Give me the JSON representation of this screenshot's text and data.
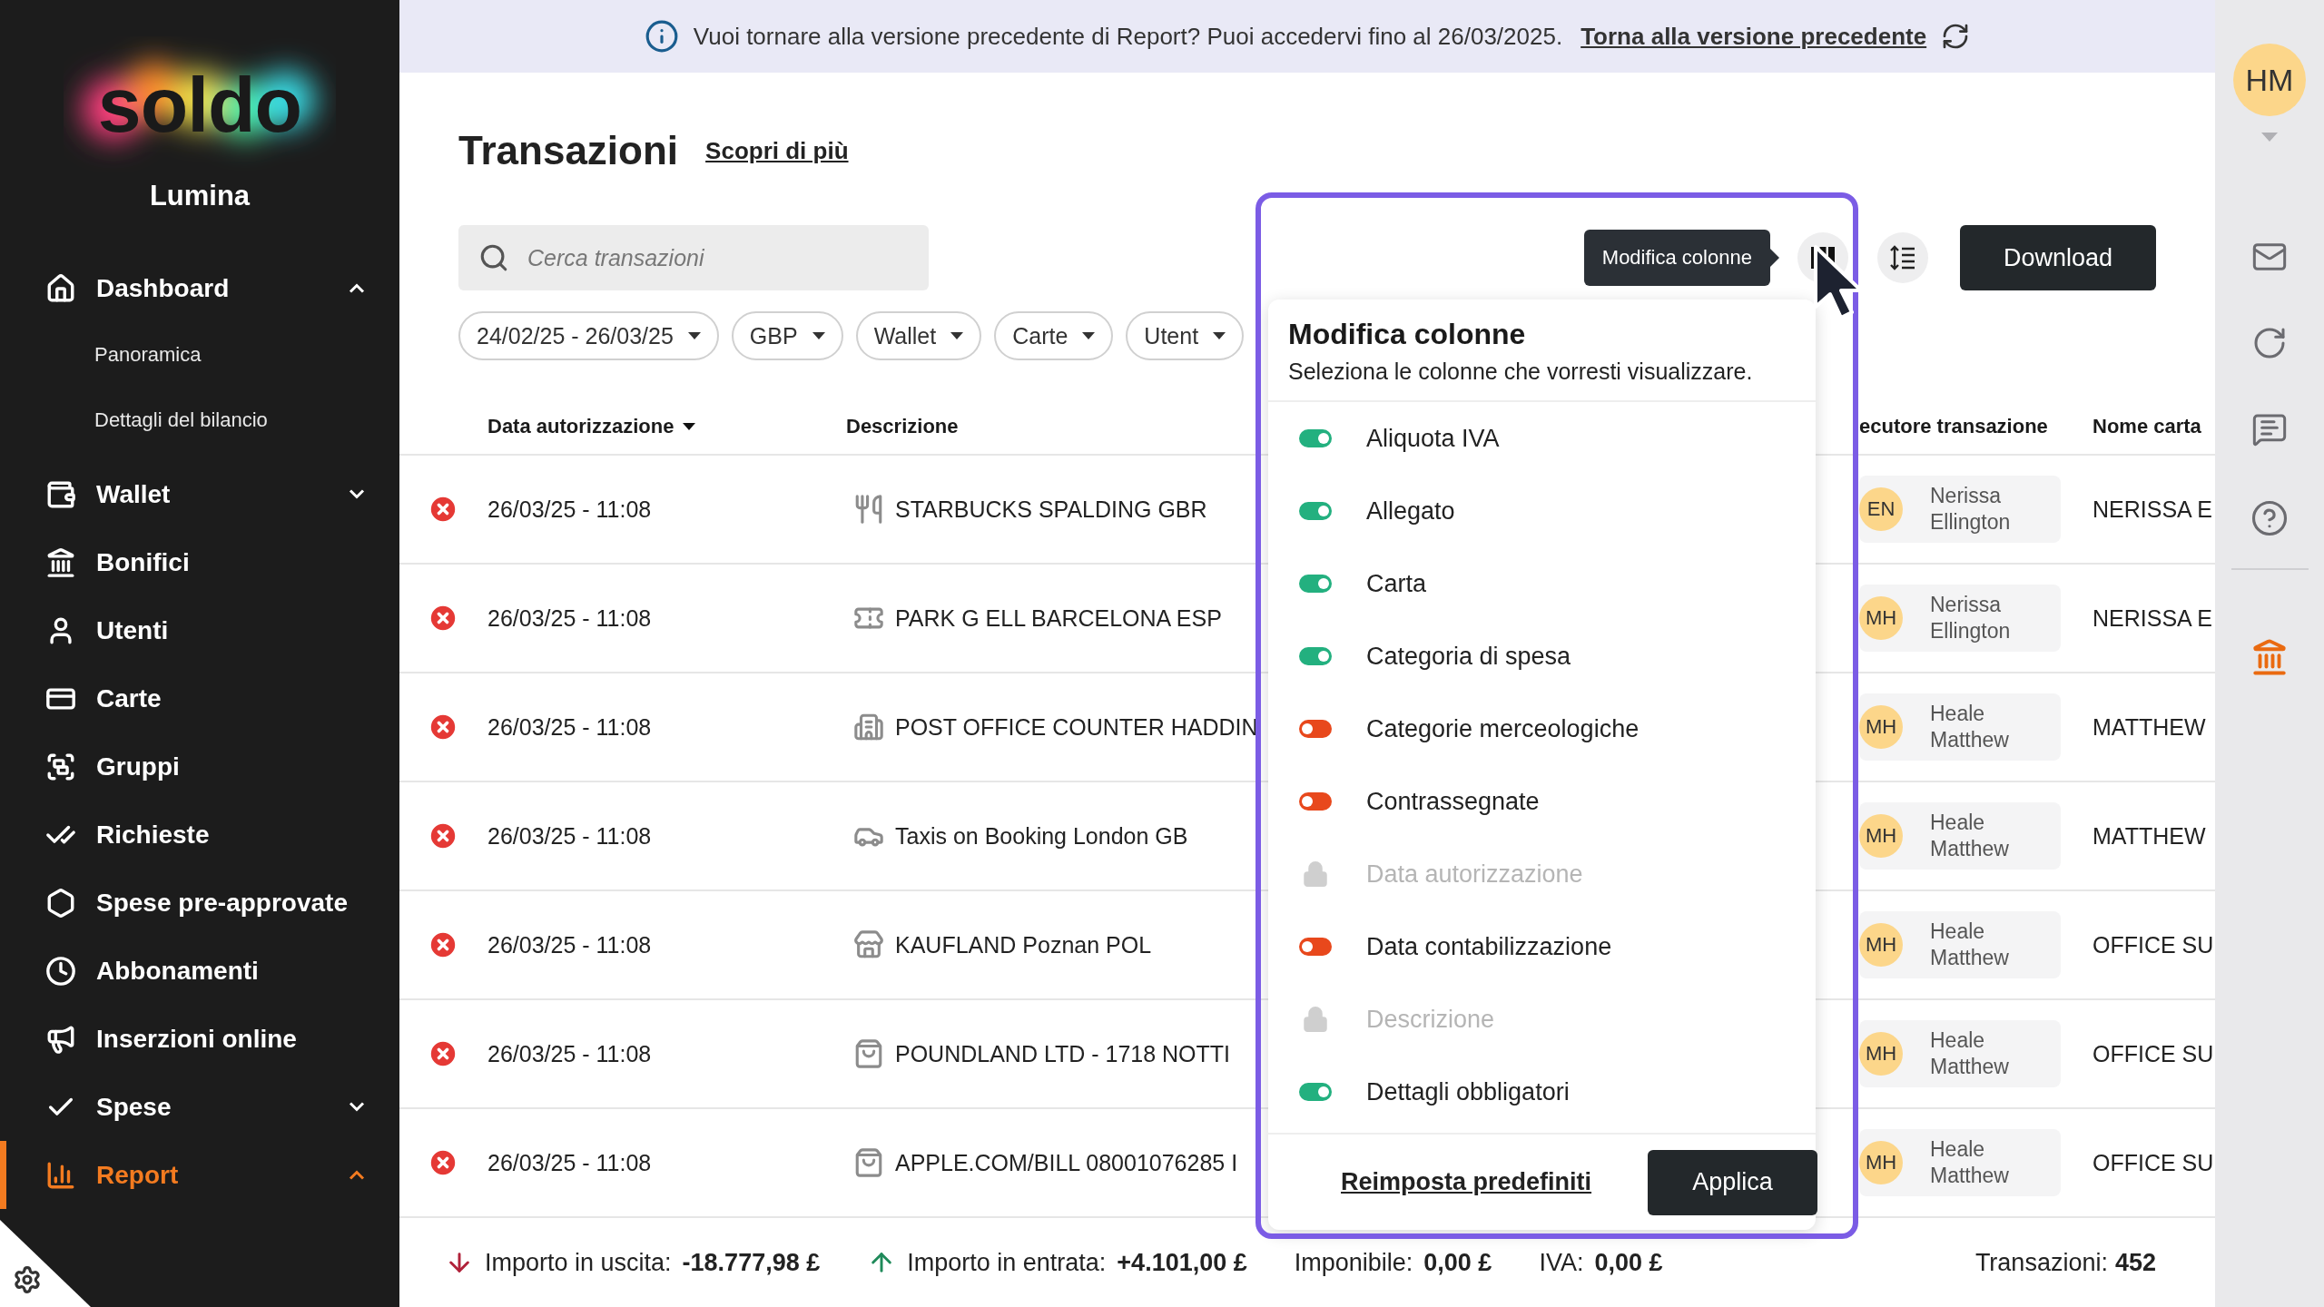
{
  "sidebar": {
    "brand": "soldo",
    "company": "Lumina",
    "items": [
      {
        "label": "Dashboard",
        "selected": false,
        "expanded": true,
        "children": [
          {
            "label": "Panoramica"
          },
          {
            "label": "Dettagli del bilancio"
          }
        ]
      },
      {
        "label": "Wallet",
        "selected": false,
        "expanded": false
      },
      {
        "label": "Bonifici",
        "selected": false
      },
      {
        "label": "Utenti",
        "selected": false
      },
      {
        "label": "Carte",
        "selected": false
      },
      {
        "label": "Gruppi",
        "selected": false
      },
      {
        "label": "Richieste",
        "selected": false
      },
      {
        "label": "Spese pre-approvate",
        "selected": false
      },
      {
        "label": "Abbonamenti",
        "selected": false
      },
      {
        "label": "Inserzioni online",
        "selected": false
      },
      {
        "label": "Spese",
        "selected": false,
        "expanded": false
      },
      {
        "label": "Report",
        "selected": true,
        "expanded": true
      }
    ]
  },
  "banner": {
    "message": "Vuoi tornare alla versione precedente di Report? Puoi accedervi fino al 26/03/2025.",
    "link": "Torna alla versione precedente"
  },
  "header": {
    "title": "Transazioni",
    "link": "Scopri di più"
  },
  "toolbar": {
    "search": {
      "placeholder": "Cerca transazioni"
    },
    "tooltip": "Modifica colonne",
    "download": "Download"
  },
  "filters": [
    {
      "label": "24/02/25 - 26/03/25"
    },
    {
      "label": "GBP"
    },
    {
      "label": "Wallet"
    },
    {
      "label": "Carte"
    },
    {
      "label": "Utent"
    }
  ],
  "table": {
    "columns": [
      {
        "label": "Data autorizzazione",
        "sorted": true
      },
      {
        "label": "Descrizione",
        "sorted": false
      },
      {
        "label": "ecutore transazione",
        "sorted": false
      },
      {
        "label": "Nome carta",
        "sorted": false
      }
    ],
    "rows": [
      {
        "date": "26/03/25 - 11:08",
        "kind": "restaurant",
        "description": "STARBUCKS SPALDING GBR",
        "executor": {
          "initials": "EN",
          "name": "Nerissa Ellington"
        },
        "card": "NERISSA E"
      },
      {
        "date": "26/03/25 - 11:08",
        "kind": "ticket",
        "description": "PARK G ELL BARCELONA ESP",
        "executor": {
          "initials": "MH",
          "name": "Nerissa Ellington"
        },
        "card": "NERISSA E"
      },
      {
        "date": "26/03/25 - 11:08",
        "kind": "building",
        "description": "POST OFFICE COUNTER HADDIN",
        "executor": {
          "initials": "MH",
          "name": "Heale Matthew"
        },
        "card": "MATTHEW"
      },
      {
        "date": "26/03/25 - 11:08",
        "kind": "car",
        "description": "Taxis on Booking London GB",
        "executor": {
          "initials": "MH",
          "name": "Heale Matthew"
        },
        "card": "MATTHEW"
      },
      {
        "date": "26/03/25 - 11:08",
        "kind": "store",
        "description": "KAUFLAND Poznan POL",
        "executor": {
          "initials": "MH",
          "name": "Heale Matthew"
        },
        "card": "OFFICE SU"
      },
      {
        "date": "26/03/25 - 11:08",
        "kind": "bag",
        "description": "POUNDLAND LTD - 1718 NOTTI",
        "executor": {
          "initials": "MH",
          "name": "Heale Matthew"
        },
        "card": "OFFICE SU"
      },
      {
        "date": "26/03/25 - 11:08",
        "kind": "bag",
        "description": "APPLE.COM/BILL 08001076285 I",
        "executor": {
          "initials": "MH",
          "name": "Heale Matthew"
        },
        "card": "OFFICE SU"
      }
    ]
  },
  "columns_menu": {
    "title": "Modifica colonne",
    "subtitle": "Seleziona le colonne che vorresti visualizzare.",
    "options": [
      {
        "label": "Aliquota IVA",
        "kind": "toggle",
        "on": true
      },
      {
        "label": "Allegato",
        "kind": "toggle",
        "on": true
      },
      {
        "label": "Carta",
        "kind": "toggle",
        "on": true
      },
      {
        "label": "Categoria di spesa",
        "kind": "toggle",
        "on": true
      },
      {
        "label": "Categorie merceologiche",
        "kind": "toggle",
        "on": false
      },
      {
        "label": "Contrassegnate",
        "kind": "toggle",
        "on": false
      },
      {
        "label": "Data autorizzazione",
        "kind": "locked"
      },
      {
        "label": "Data contabilizzazione",
        "kind": "toggle",
        "on": false
      },
      {
        "label": "Descrizione",
        "kind": "locked"
      },
      {
        "label": "Dettagli obbligatori",
        "kind": "toggle",
        "on": true
      }
    ],
    "reset": "Reimposta predefiniti",
    "apply": "Applica"
  },
  "totals": [
    {
      "kind": "outgoing",
      "label": "Importo in uscita:",
      "value": "-18.777,98 £"
    },
    {
      "kind": "incoming",
      "label": "Importo in entrata:",
      "value": "+4.101,00 £"
    },
    {
      "kind": "plain",
      "label": "Imponibile:",
      "value": "0,00 £"
    },
    {
      "kind": "plain",
      "label": "IVA:",
      "value": "0,00 £"
    }
  ],
  "count": {
    "label": "Transazioni:",
    "value": "452"
  },
  "user": {
    "initials": "HM"
  }
}
